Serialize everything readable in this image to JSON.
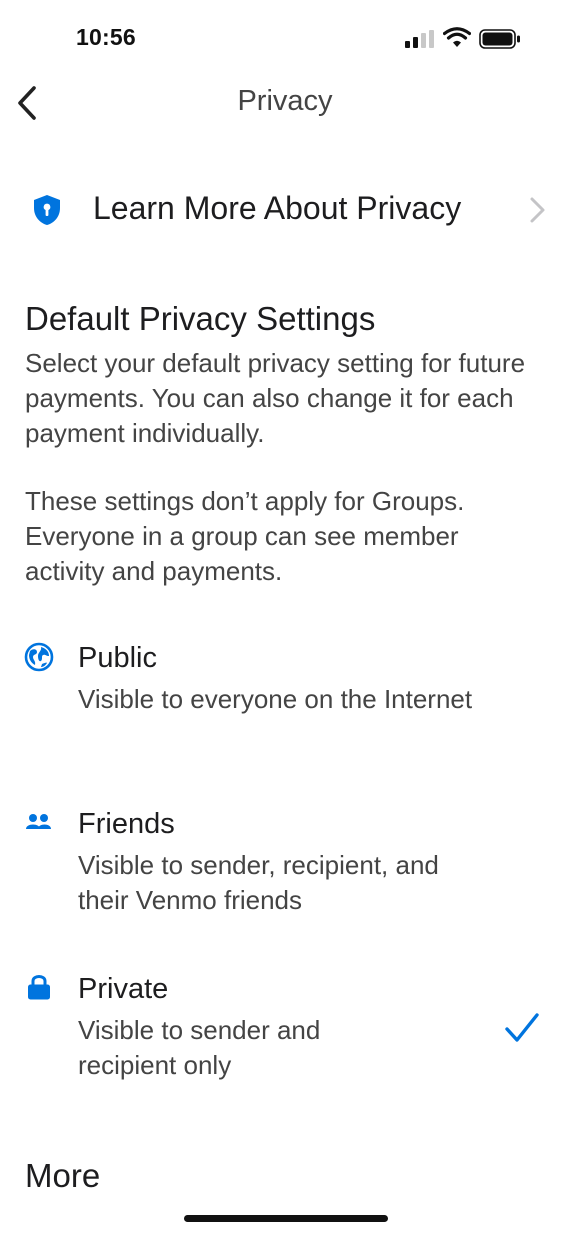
{
  "status_bar": {
    "time": "10:56"
  },
  "nav": {
    "title": "Privacy"
  },
  "learn_more": {
    "label": "Learn More About Privacy"
  },
  "default_section": {
    "heading": "Default Privacy Settings",
    "description": "Select your default privacy setting for future payments. You can also change it for each payment individually.",
    "groups_note": "These settings don’t apply for Groups. Everyone in a group can see member activity and payments."
  },
  "options": [
    {
      "label": "Public",
      "description": "Visible to everyone on the Internet",
      "icon": "globe-icon",
      "selected": false
    },
    {
      "label": "Friends",
      "description": "Visible to sender, recipient, and their Venmo friends",
      "icon": "friends-icon",
      "selected": false
    },
    {
      "label": "Private",
      "description": "Visible to sender and recipient only",
      "icon": "lock-icon",
      "selected": true
    }
  ],
  "more_section": {
    "heading": "More"
  },
  "colors": {
    "accent": "#0074DE",
    "text": "#1d1d1f",
    "secondary_text": "#444444"
  }
}
